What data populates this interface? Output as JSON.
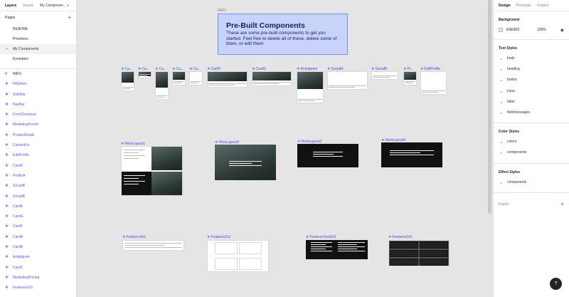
{
  "left_panel": {
    "tabs": [
      "Layers",
      "Assets",
      "My Componen..."
    ],
    "pages_label": "Pages",
    "pages": [
      "README",
      "Primitives",
      "My Components",
      "Examples"
    ],
    "active_page": "My Components",
    "info_layer": "INFO",
    "layers": [
      "FAQItem",
      "SideBar",
      "NavBar",
      "FormCheckout",
      "MarketingFooter",
      "ProductDetail",
      "ContactUs",
      "EditProfile",
      "CardD",
      "ProfileA",
      "SocialB",
      "SocialA",
      "CardE",
      "CardG",
      "CardF",
      "CardA",
      "CardB",
      "Ampligram",
      "CardC",
      "MarketingPricing",
      "Features2x3"
    ]
  },
  "canvas": {
    "info_label": "INFO",
    "info_title": "Pre-Built Components",
    "info_body": "These are some pre-built components to get you started. Feel free to delete all of these, delete some of them, or edit them.",
    "row1_labels": [
      "Ca...",
      "Ca...",
      "Ca...",
      "Ca...",
      "Ca...",
      "CardF",
      "CardG",
      "Ampligram",
      "SocialA",
      "SocialB",
      "Pr...",
      "EditProfile"
    ],
    "row2_labels": [
      "HeroLayout1",
      "HeroLayout2",
      "HeroLayout3",
      "HeroLayout4"
    ],
    "row3_labels": [
      "Features4x1",
      "Features2x2",
      "FeaturesText2x2",
      "Features2x3"
    ]
  },
  "right_panel": {
    "tabs": [
      "Design",
      "Prototype",
      "Inspect"
    ],
    "background_title": "Background",
    "background_hex": "E5E5E5",
    "background_opacity": "100%",
    "text_styles_title": "Text Styles",
    "text_styles": [
      "body",
      "heading",
      "button",
      "input",
      "label",
      "fieldmessages"
    ],
    "color_styles_title": "Color Styles",
    "color_styles": [
      "colors",
      "components"
    ],
    "effect_styles_title": "Effect Styles",
    "effect_styles": [
      "components"
    ],
    "export_label": "Export"
  },
  "help_label": "?"
}
